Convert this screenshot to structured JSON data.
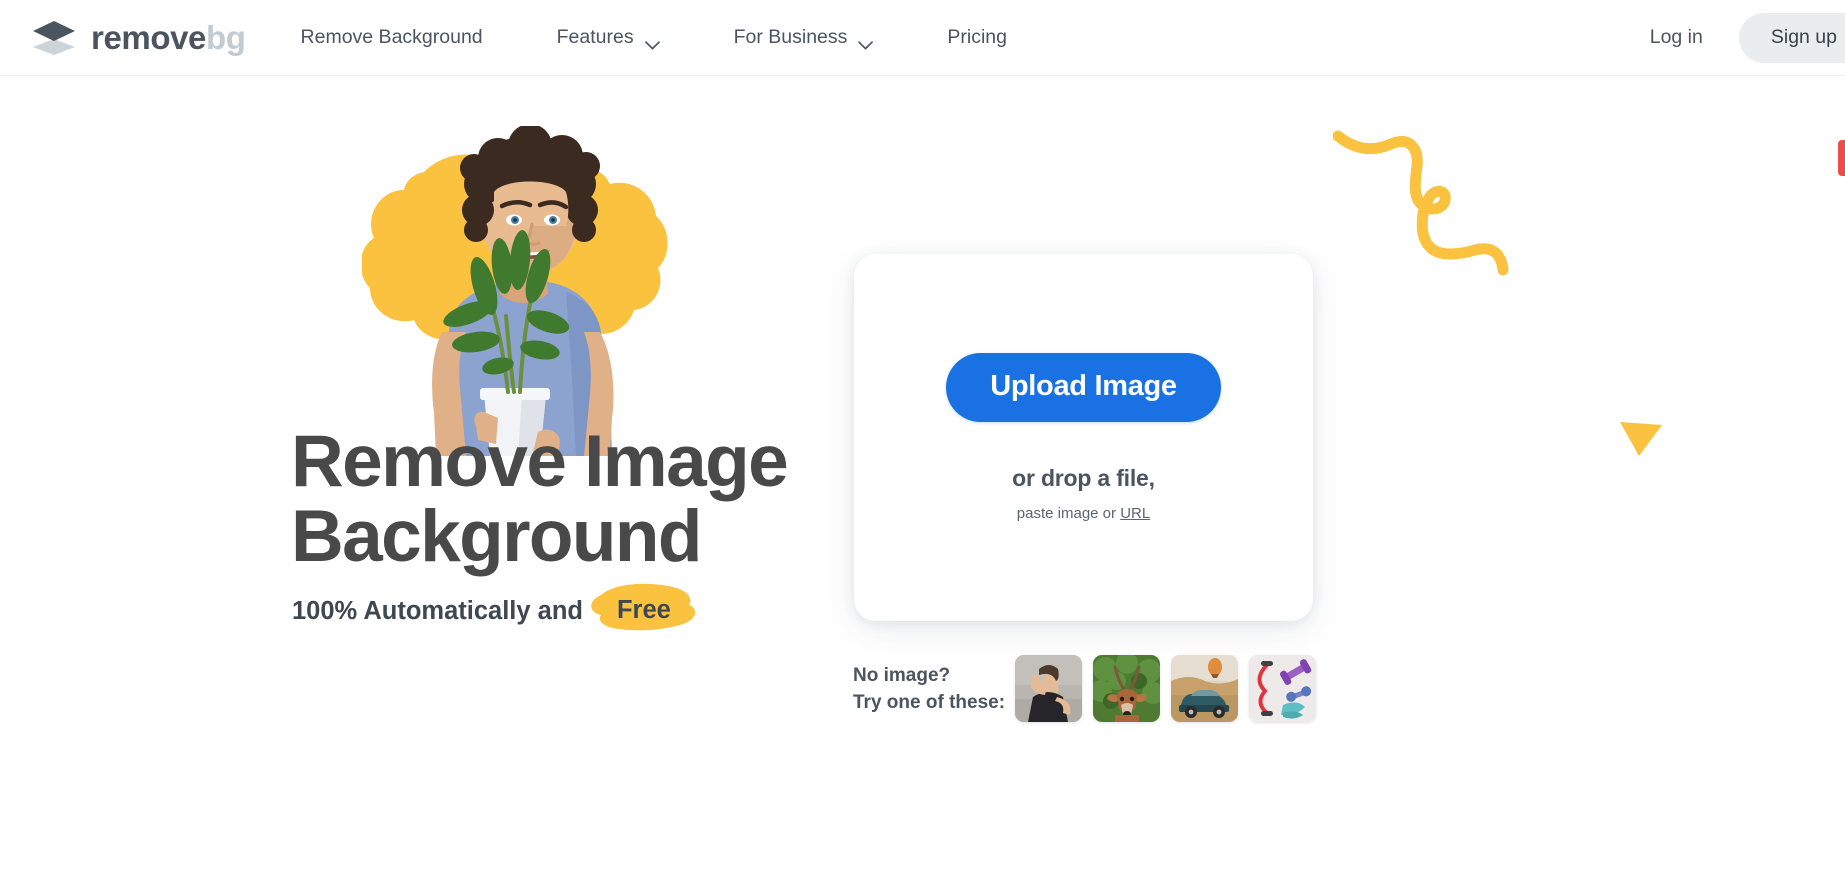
{
  "brand": {
    "name_primary": "remove",
    "name_secondary": "bg",
    "logo_icon": "stacked-layers-diamond-icon",
    "accent_blue": "#1a71e3",
    "accent_yellow": "#fbc23f",
    "text_dark": "#4a5560",
    "heading_gray": "#494949"
  },
  "header": {
    "nav": [
      {
        "label": "Remove Background",
        "has_dropdown": false,
        "icon": ""
      },
      {
        "label": "Features",
        "has_dropdown": true,
        "icon": "chevron-down-icon"
      },
      {
        "label": "For Business",
        "has_dropdown": true,
        "icon": "chevron-down-icon"
      },
      {
        "label": "Pricing",
        "has_dropdown": false,
        "icon": ""
      }
    ],
    "login_label": "Log in",
    "signup_label": "Sign up"
  },
  "hero": {
    "title_line1": "Remove Image",
    "title_line2": "Background",
    "subtitle_prefix": "100% Automatically and",
    "subtitle_highlight": "Free",
    "image_alt": "man-with-plant-photo",
    "blob_shape": "yellow-organic-blob"
  },
  "upload": {
    "button_label": "Upload Image",
    "drop_label": "or drop a file,",
    "paste_prefix": "paste image or",
    "paste_link": "URL"
  },
  "samples": {
    "label_line1": "No image?",
    "label_line2": "Try one of these:",
    "thumbnails": [
      {
        "name": "sample-woman-flexing",
        "alt": "woman flexing arm against concrete wall"
      },
      {
        "name": "sample-impala",
        "alt": "impala antelope in green foliage"
      },
      {
        "name": "sample-vintage-car",
        "alt": "vintage convertible car with hot air balloon"
      },
      {
        "name": "sample-fitness-gear",
        "alt": "dumbbells resistance band and mat"
      }
    ]
  },
  "decorations": {
    "squiggle": "yellow-squiggle-line",
    "triangle": "yellow-triangle-down",
    "red_bar": "red-edge-bar"
  }
}
